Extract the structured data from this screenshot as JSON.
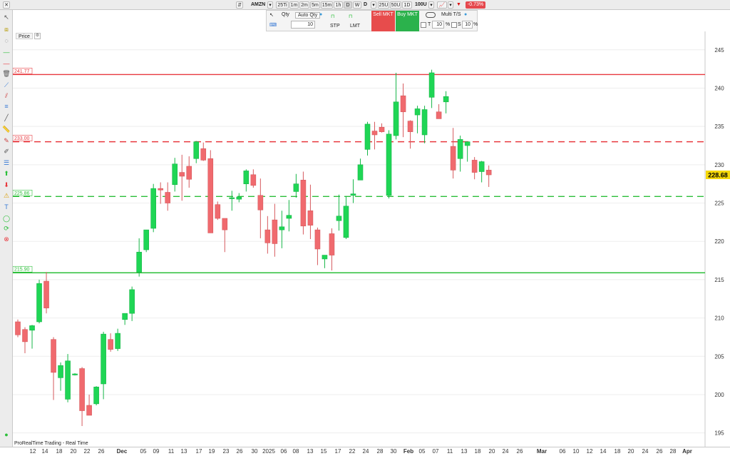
{
  "toolbar": {
    "ticker": "AMZN",
    "timeframes": [
      "25Ti",
      "1m",
      "2m",
      "5m",
      "15m",
      "1h",
      "D",
      "W",
      "D"
    ],
    "active_timeframe": "D",
    "units": [
      "25U",
      "50U",
      "1D",
      "100U"
    ],
    "change_pct": "-0.73%"
  },
  "order_panel": {
    "qty_label": "Qty",
    "auto_qty_label": "Auto Qty",
    "qty_value": "10",
    "stp_label": "STP",
    "lmt_label": "LMT",
    "sell_label": "Sell MKT",
    "buy_label": "Buy MKT",
    "multi_label": "Multi T/S",
    "t_label": "T",
    "t_value": "10",
    "s_label": "S",
    "s_value": "10",
    "pct": "%"
  },
  "chart": {
    "price_tab": "Price",
    "footer": "ProRealTime Trading - Real Time",
    "current_price": "228.68",
    "colors": {
      "up": "#1fd655",
      "down": "#f06a6e",
      "resistance": "#e8393f",
      "support": "#2cbf3a",
      "last_price": "#f5d80a"
    }
  },
  "chart_data": {
    "type": "candlestick",
    "y_ticks": [
      195,
      200,
      205,
      210,
      215,
      220,
      225,
      230,
      235,
      240,
      245
    ],
    "x_ticks": [
      "12",
      "14",
      "18",
      "20",
      "22",
      "26",
      "Dec",
      "05",
      "09",
      "11",
      "13",
      "17",
      "19",
      "23",
      "26",
      "30",
      "2025",
      "06",
      "08",
      "13",
      "15",
      "17",
      "22",
      "24",
      "28",
      "30",
      "Feb",
      "05",
      "07",
      "11",
      "13",
      "18",
      "20",
      "24",
      "26",
      "Mar",
      "06",
      "10",
      "12",
      "14",
      "18",
      "20",
      "24",
      "26",
      "28",
      "Apr"
    ],
    "ylim": [
      193.2,
      247.4
    ],
    "levels": [
      {
        "label": "241.77",
        "value": 241.77,
        "style": "solid",
        "kind": "resistance"
      },
      {
        "label": "233.00",
        "value": 233.0,
        "style": "dashed",
        "kind": "resistance"
      },
      {
        "label": "225.86",
        "value": 225.86,
        "style": "dashed",
        "kind": "support"
      },
      {
        "label": "215.90",
        "value": 215.9,
        "style": "solid",
        "kind": "support"
      }
    ],
    "candles": [
      {
        "o": 209.5,
        "h": 209.8,
        "l": 207.5,
        "c": 207.8
      },
      {
        "o": 208.5,
        "h": 208.8,
        "l": 205.4,
        "c": 206.9
      },
      {
        "o": 208.4,
        "h": 209.1,
        "l": 206.0,
        "c": 209.0
      },
      {
        "o": 209.5,
        "h": 215.0,
        "l": 209.3,
        "c": 214.5
      },
      {
        "o": 214.8,
        "h": 216.0,
        "l": 210.6,
        "c": 211.3
      },
      {
        "o": 207.2,
        "h": 207.5,
        "l": 199.3,
        "c": 202.9
      },
      {
        "o": 202.2,
        "h": 204.2,
        "l": 200.5,
        "c": 203.8
      },
      {
        "o": 199.4,
        "h": 205.3,
        "l": 199.0,
        "c": 204.4
      },
      {
        "o": 202.6,
        "h": 202.8,
        "l": 202.5,
        "c": 202.7
      },
      {
        "o": 203.4,
        "h": 203.6,
        "l": 195.9,
        "c": 197.9
      },
      {
        "o": 198.6,
        "h": 200.0,
        "l": 197.4,
        "c": 197.3
      },
      {
        "o": 198.8,
        "h": 201.1,
        "l": 198.6,
        "c": 201.0
      },
      {
        "o": 201.4,
        "h": 208.2,
        "l": 199.4,
        "c": 207.9
      },
      {
        "o": 207.2,
        "h": 208.0,
        "l": 205.6,
        "c": 205.9
      },
      {
        "o": 206.0,
        "h": 208.6,
        "l": 205.7,
        "c": 208.0
      },
      {
        "o": 209.8,
        "h": 210.4,
        "l": 209.1,
        "c": 210.6
      },
      {
        "o": 210.6,
        "h": 214.1,
        "l": 209.6,
        "c": 213.7
      },
      {
        "o": 216.0,
        "h": 220.4,
        "l": 215.4,
        "c": 218.6
      },
      {
        "o": 218.9,
        "h": 221.1,
        "l": 218.6,
        "c": 221.5
      },
      {
        "o": 221.7,
        "h": 227.5,
        "l": 221.2,
        "c": 226.9
      },
      {
        "o": 226.9,
        "h": 227.7,
        "l": 224.9,
        "c": 226.7
      },
      {
        "o": 226.4,
        "h": 227.7,
        "l": 224.0,
        "c": 225.0
      },
      {
        "o": 227.4,
        "h": 230.9,
        "l": 226.5,
        "c": 230.1
      },
      {
        "o": 229.0,
        "h": 231.3,
        "l": 225.3,
        "c": 228.5
      },
      {
        "o": 229.8,
        "h": 231.1,
        "l": 227.0,
        "c": 228.1
      },
      {
        "o": 230.8,
        "h": 233.1,
        "l": 230.2,
        "c": 233.0
      },
      {
        "o": 232.1,
        "h": 232.9,
        "l": 230.5,
        "c": 230.6
      },
      {
        "o": 230.8,
        "h": 231.9,
        "l": 227.3,
        "c": 221.1
      },
      {
        "o": 224.8,
        "h": 225.2,
        "l": 222.8,
        "c": 223.0
      },
      {
        "o": 223.0,
        "h": 222.2,
        "l": 218.6,
        "c": 221.5
      },
      {
        "o": 225.6,
        "h": 226.6,
        "l": 224.0,
        "c": 225.7
      },
      {
        "o": 225.5,
        "h": 226.3,
        "l": 225.1,
        "c": 225.8
      },
      {
        "o": 227.5,
        "h": 229.4,
        "l": 226.5,
        "c": 229.2
      },
      {
        "o": 228.7,
        "h": 229.4,
        "l": 227.0,
        "c": 227.3
      },
      {
        "o": 226.0,
        "h": 228.2,
        "l": 220.4,
        "c": 224.1
      },
      {
        "o": 221.5,
        "h": 223.3,
        "l": 218.4,
        "c": 219.8
      },
      {
        "o": 222.8,
        "h": 224.9,
        "l": 218.0,
        "c": 219.7
      },
      {
        "o": 221.5,
        "h": 224.0,
        "l": 219.1,
        "c": 221.9
      },
      {
        "o": 223.0,
        "h": 225.4,
        "l": 221.3,
        "c": 223.4
      },
      {
        "o": 226.5,
        "h": 228.8,
        "l": 225.7,
        "c": 227.5
      },
      {
        "o": 228.0,
        "h": 229.1,
        "l": 220.9,
        "c": 222.0
      },
      {
        "o": 224.0,
        "h": 227.4,
        "l": 220.3,
        "c": 222.1
      },
      {
        "o": 221.5,
        "h": 221.8,
        "l": 216.9,
        "c": 219.0
      },
      {
        "o": 217.7,
        "h": 217.9,
        "l": 216.5,
        "c": 218.2
      },
      {
        "o": 221.0,
        "h": 221.7,
        "l": 216.2,
        "c": 218.2
      },
      {
        "o": 222.7,
        "h": 226.1,
        "l": 221.4,
        "c": 223.3
      },
      {
        "o": 220.5,
        "h": 225.9,
        "l": 220.3,
        "c": 224.6
      },
      {
        "o": 226.0,
        "h": 228.1,
        "l": 225.0,
        "c": 226.2
      },
      {
        "o": 228.0,
        "h": 230.8,
        "l": 228.0,
        "c": 230.0
      },
      {
        "o": 232.0,
        "h": 235.6,
        "l": 231.2,
        "c": 235.3
      },
      {
        "o": 234.4,
        "h": 235.6,
        "l": 232.0,
        "c": 233.9
      },
      {
        "o": 234.9,
        "h": 235.4,
        "l": 234.2,
        "c": 234.3
      },
      {
        "o": 226.0,
        "h": 234.5,
        "l": 225.6,
        "c": 234.0
      },
      {
        "o": 233.8,
        "h": 242.0,
        "l": 233.3,
        "c": 238.2
      },
      {
        "o": 239.0,
        "h": 240.6,
        "l": 233.6,
        "c": 236.9
      },
      {
        "o": 235.7,
        "h": 235.8,
        "l": 232.1,
        "c": 234.3
      },
      {
        "o": 236.5,
        "h": 237.7,
        "l": 234.1,
        "c": 237.3
      },
      {
        "o": 233.9,
        "h": 237.7,
        "l": 232.8,
        "c": 237.2
      },
      {
        "o": 238.8,
        "h": 242.4,
        "l": 237.4,
        "c": 242.0
      },
      {
        "o": 236.9,
        "h": 237.9,
        "l": 236.2,
        "c": 236.0
      },
      {
        "o": 238.2,
        "h": 239.6,
        "l": 236.7,
        "c": 238.9
      },
      {
        "o": 232.4,
        "h": 234.8,
        "l": 228.2,
        "c": 229.3
      },
      {
        "o": 230.8,
        "h": 233.8,
        "l": 229.1,
        "c": 233.3
      },
      {
        "o": 232.5,
        "h": 233.0,
        "l": 230.4,
        "c": 233.0
      },
      {
        "o": 230.6,
        "h": 231.0,
        "l": 228.1,
        "c": 229.0
      },
      {
        "o": 229.1,
        "h": 230.5,
        "l": 227.7,
        "c": 230.4
      },
      {
        "o": 229.3,
        "h": 229.9,
        "l": 227.1,
        "c": 228.68
      }
    ]
  }
}
